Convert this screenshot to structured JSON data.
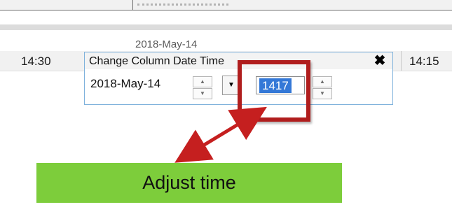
{
  "header": {
    "date_label": "2018-May-14"
  },
  "row": {
    "time_left": "14:30",
    "time_right": "14:15"
  },
  "dialog": {
    "title": "Change Column Date Time",
    "date_value": "2018-May-14",
    "time_value": "1417",
    "close_icon": "close-icon"
  },
  "annotation": {
    "label": "Adjust time",
    "highlight_color": "#b01d1d",
    "label_background": "#7dcd3b",
    "arrow_color": "#c51f1f"
  }
}
